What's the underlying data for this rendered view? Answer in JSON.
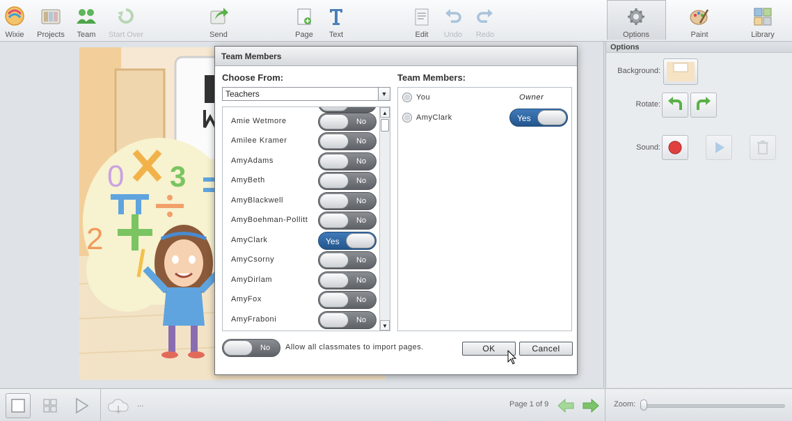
{
  "toolbar": {
    "items": [
      {
        "label": "Wixie",
        "icon": "wixie-logo-icon",
        "enabled": true
      },
      {
        "label": "Projects",
        "icon": "projects-icon",
        "enabled": true
      },
      {
        "label": "Team",
        "icon": "team-icon",
        "enabled": true
      },
      {
        "label": "Start Over",
        "icon": "start-over-icon",
        "enabled": false
      },
      {
        "label": "Send",
        "icon": "send-icon",
        "enabled": true
      },
      {
        "label": "Page",
        "icon": "page-icon",
        "enabled": true
      },
      {
        "label": "Text",
        "icon": "text-icon",
        "enabled": true
      },
      {
        "label": "Edit",
        "icon": "edit-icon",
        "enabled": true
      },
      {
        "label": "Undo",
        "icon": "undo-icon",
        "enabled": false
      },
      {
        "label": "Redo",
        "icon": "redo-icon",
        "enabled": false
      },
      {
        "label": "Options",
        "icon": "gear-icon",
        "enabled": true,
        "selected": true
      },
      {
        "label": "Paint",
        "icon": "paint-icon",
        "enabled": true
      },
      {
        "label": "Library",
        "icon": "library-icon",
        "enabled": true
      }
    ]
  },
  "panel": {
    "title": "Options",
    "background_label": "Background:",
    "rotate_label": "Rotate:",
    "sound_label": "Sound:"
  },
  "bottom": {
    "ellipsis": "...",
    "page_count": "Page 1 of 9",
    "zoom_label": "Zoom:"
  },
  "modal": {
    "title": "Team Members",
    "choose_from_label": "Choose From:",
    "choose_from_value": "Teachers",
    "team_members_label": "Team Members:",
    "students": [
      {
        "name": "Amie Wetmore",
        "state": "No"
      },
      {
        "name": "Amilee Kramer",
        "state": "No"
      },
      {
        "name": "AmyAdams",
        "state": "No"
      },
      {
        "name": "AmyBeth",
        "state": "No"
      },
      {
        "name": "AmyBlackwell",
        "state": "No"
      },
      {
        "name": "AmyBoehman-Pollitt",
        "state": "No"
      },
      {
        "name": "AmyClark",
        "state": "Yes"
      },
      {
        "name": "AmyCsorny",
        "state": "No"
      },
      {
        "name": "AmyDirlam",
        "state": "No"
      },
      {
        "name": "AmyFox",
        "state": "No"
      },
      {
        "name": "AmyFraboni",
        "state": "No"
      }
    ],
    "members": [
      {
        "name": "You",
        "role": "Owner"
      },
      {
        "name": "AmyClark",
        "state": "Yes"
      }
    ],
    "allow_toggle_state": "No",
    "allow_text": "Allow all classmates to import pages.",
    "ok_label": "OK",
    "cancel_label": "Cancel"
  },
  "colors": {
    "toggle_on": "#2f6aa6",
    "toggle_off": "#6f7378",
    "accent_green": "#5bb04a"
  }
}
